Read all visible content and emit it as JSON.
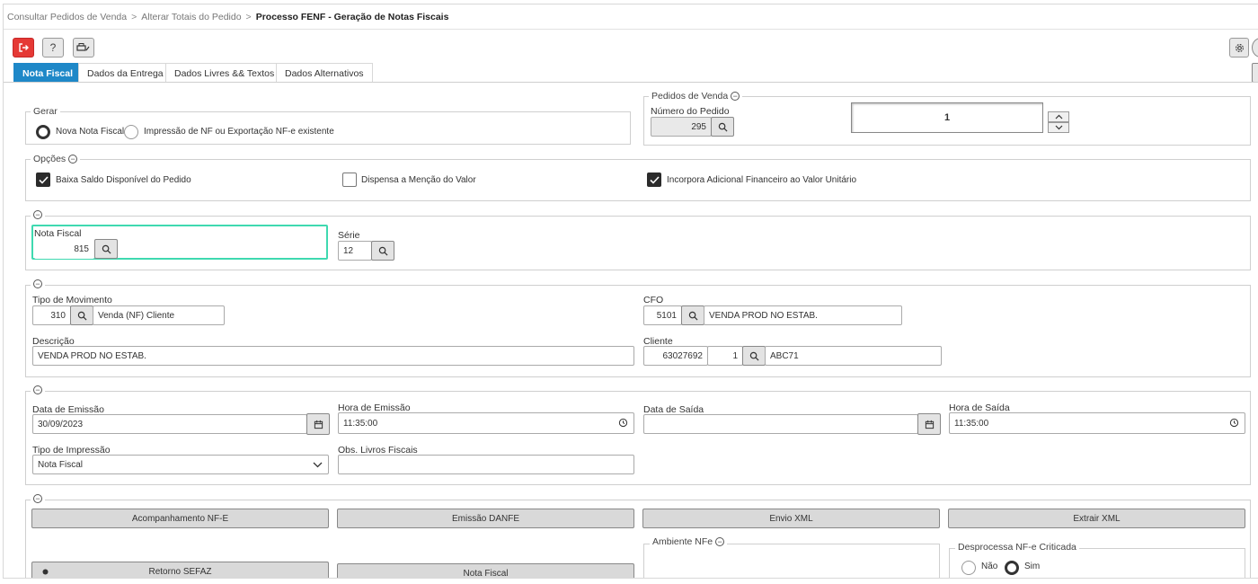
{
  "breadcrumb": {
    "item1": "Consultar Pedidos de Venda",
    "item2": "Alterar Totais do Pedido",
    "current": "Processo FENF - Geração de Notas Fiscais",
    "separator": ">"
  },
  "toolbar": {
    "exit_icon": "exit-icon",
    "help_label": "?",
    "print_icon": "printer-icon",
    "settings_icon": "gear-icon"
  },
  "tabs": [
    {
      "label": "Nota Fiscal"
    },
    {
      "label": "Dados da Entrega"
    },
    {
      "label": "Dados Livres && Textos"
    },
    {
      "label": "Dados Alternativos"
    }
  ],
  "gerar": {
    "legend": "Gerar",
    "option_nova": "Nova Nota Fiscal",
    "option_impressao": "Impressão de NF ou Exportação NF-e existente",
    "selected": "Nova Nota Fiscal"
  },
  "pedidos": {
    "legend": "Pedidos de Venda",
    "numero_label": "Número do Pedido",
    "numero_value": "295",
    "counter_value": "1"
  },
  "opcoes": {
    "legend": "Opções",
    "baixa_saldo": {
      "label": "Baixa Saldo Disponível do Pedido",
      "checked": true
    },
    "dispensa": {
      "label": "Dispensa a Menção do Valor",
      "checked": false
    },
    "incorpora": {
      "label": "Incorpora Adicional Financeiro ao Valor Unitário",
      "checked": true
    }
  },
  "nota": {
    "nota_label": "Nota Fiscal",
    "nota_value": "815",
    "serie_label": "Série",
    "serie_value": "12",
    "highlight_color": "#3fd9b0"
  },
  "movimento": {
    "tipo_label": "Tipo de Movimento",
    "tipo_code": "310",
    "tipo_desc": "Venda (NF) Cliente",
    "cfo_label": "CFO",
    "cfo_code": "5101",
    "cfo_desc": "VENDA PROD NO ESTAB.",
    "descricao_label": "Descrição",
    "descricao_value": "VENDA PROD NO ESTAB.",
    "cliente_label": "Cliente",
    "cliente_code": "63027692",
    "cliente_seq": "1",
    "cliente_name": "ABC71"
  },
  "datas": {
    "emissao_label": "Data de Emissão",
    "emissao_value": "30/09/2023",
    "hora_emissao_label": "Hora de Emissão",
    "hora_emissao_value": "11:35:00",
    "saida_label": "Data de Saída",
    "saida_value": "",
    "hora_saida_label": "Hora de Saída",
    "hora_saida_value": "11:35:00",
    "tipo_impressao_label": "Tipo de Impressão",
    "tipo_impressao_value": "Nota Fiscal",
    "obs_label": "Obs. Livros Fiscais",
    "obs_value": ""
  },
  "actions": {
    "acompanhamento": "Acompanhamento NF-E",
    "emissao_danfe": "Emissão DANFE",
    "envio_xml": "Envio XML",
    "extrair_xml": "Extrair XML",
    "retorno_sefaz": "Retorno SEFAZ",
    "nota_fiscal": "Nota Fiscal",
    "ambiente_legend": "Ambiente NFe",
    "desprocessa_legend": "Desprocessa NF-e Criticada",
    "opt_nao": "Não",
    "opt_sim": "Sim",
    "desprocessa_selected": "Sim"
  }
}
